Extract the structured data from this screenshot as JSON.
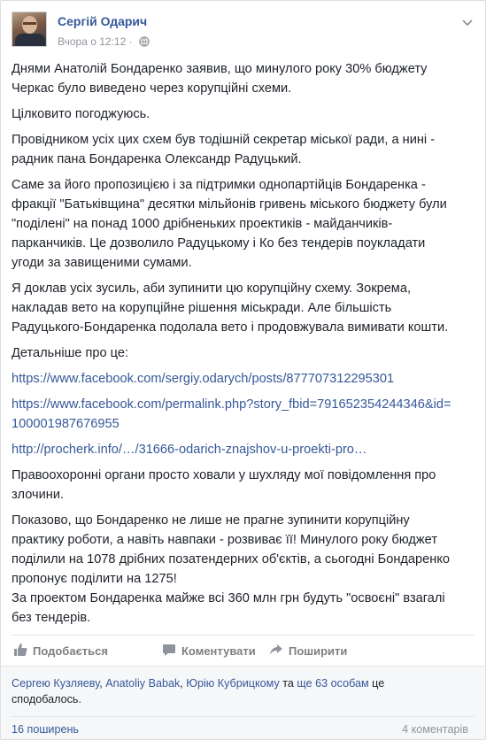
{
  "author": {
    "name": "Сергій Одарич",
    "timestamp": "Вчора о 12:12 ·"
  },
  "post": {
    "paragraphs": [
      "Днями Анатолій Бондаренко заявив, що минулого року 30% бюджету Черкас було виведено через корупційні схеми.",
      "Цілковито погоджуюсь.",
      "Провідником усіх цих схем був тодішній секретар міської ради, а нині - радник пана Бондаренка Олександр Радуцький.",
      "Саме за його пропозицією і за підтримки однопартійців Бондаренка - фракції \"Батьківщина\" десятки мільйонів гривень міського бюджету були \"поділені\" на понад 1000 дрібненьких проектиків - майданчиків-парканчиків. Це дозволило Радуцькому і Ко без тендерів поукладати угоди за завищеними сумами.",
      "Я доклав усіх зусиль, аби зупинити цю корупційну схему. Зокрема, накладав вето на корупційне рішення міськради. Але більшість Радуцького-Бондаренка подолала вето і продовжувала вимивати кошти.",
      "Детальніше про це:"
    ],
    "links": [
      "https://www.facebook.com/sergiy.odarych/posts/877707312295301",
      "https://www.facebook.com/permalink.php?story_fbid=791652354244346&id=100001987676955",
      "http://procherk.info/…/31666-odarich-znajshov-u-proekti-pro…"
    ],
    "after": [
      "Правоохоронні органи просто ховали у шухляду мої повідомлення про злочини.",
      "Показово, що Бондаренко не лише не прагне зупинити корупційну практику роботи, а навіть навпаки - розвиває її! Минулого року бюджет поділили на 1078 дрібних позатендерних об'єктів, а сьогодні Бондаренко пропонує поділити на 1275!",
      "За проектом Бондаренка майже всі 360 млн грн будуть \"освоєні\" взагалі без тендерів."
    ]
  },
  "actions": {
    "like": "Подобається",
    "comment": "Коментувати",
    "share": "Поширити"
  },
  "footer": {
    "likers": [
      "Сергею Кузляеву",
      "Anatoliy Babak",
      "Юрію Кубрицкому"
    ],
    "and": "та",
    "others": "ще 63 особам",
    "suffix": "це сподобалось.",
    "shares": "16 поширень",
    "comments": "4 коментарів"
  },
  "colors": {
    "link": "#365899",
    "muted": "#90949c",
    "text": "#1d2129"
  }
}
